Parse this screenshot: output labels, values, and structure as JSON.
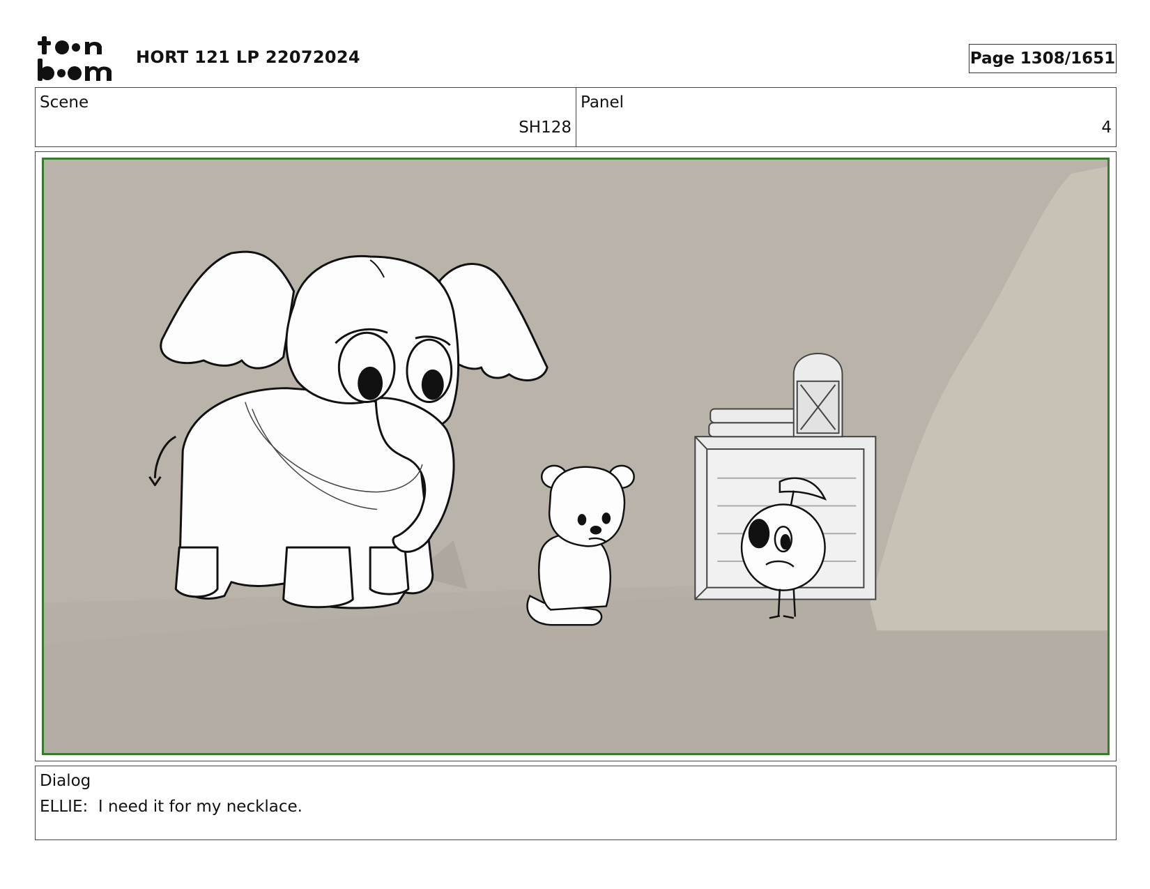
{
  "header": {
    "title": "HORT 121 LP 22072024",
    "page": "Page 1308/1651"
  },
  "scene": {
    "label": "Scene",
    "value": "SH128"
  },
  "panel": {
    "label": "Panel",
    "value": "4"
  },
  "dialog": {
    "label": "Dialog",
    "text": "ELLIE:  I need it for my necklace."
  },
  "colors": {
    "frame_border": "#3a7a2e",
    "background": "#bbb4ac"
  }
}
